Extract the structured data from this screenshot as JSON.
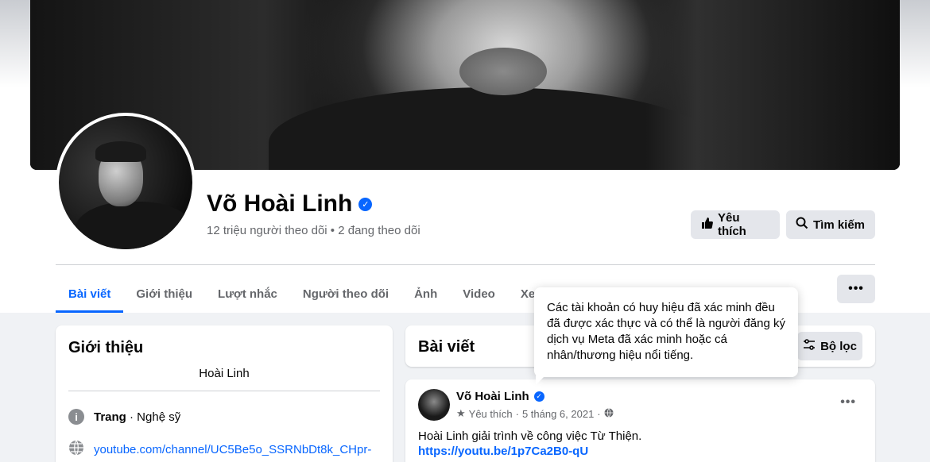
{
  "profile": {
    "name": "Võ Hoài Linh",
    "followers": "12 triệu người theo dõi • 2 đang theo dõi"
  },
  "actions": {
    "like_label": "Yêu thích",
    "search_label": "Tìm kiếm"
  },
  "tabs": [
    {
      "label": "Bài viết",
      "active": true
    },
    {
      "label": "Giới thiệu"
    },
    {
      "label": "Lượt nhắc"
    },
    {
      "label": "Người theo dõi"
    },
    {
      "label": "Ảnh"
    },
    {
      "label": "Video"
    },
    {
      "label": "Xem thêm ▾"
    }
  ],
  "more_label": "•••",
  "intro": {
    "title": "Giới thiệu",
    "alias": "Hoài Linh",
    "page_type_bold": "Trang",
    "page_type_rest": " · Nghệ sỹ",
    "website": "youtube.com/channel/UC5Be5o_SSRNbDt8k_CHpr-"
  },
  "posts": {
    "title": "Bài viết",
    "filter_label": "Bộ lọc"
  },
  "post": {
    "author": "Võ Hoài Linh",
    "meta_label": "Yêu thích",
    "date": "5 tháng 6, 2021",
    "text": "Hoài Linh giải trình về công việc Từ Thiện.",
    "link": "https://youtu.be/1p7Ca2B0-qU"
  },
  "tooltip": {
    "text": "Các tài khoản có huy hiệu đã xác minh đều đã được xác thực và có thể là người đăng ký dịch vụ Meta đã xác minh hoặc cá nhân/thương hiệu nổi tiếng."
  },
  "colors": {
    "accent": "#0866ff",
    "background": "#f0f2f5",
    "button": "#e4e6eb"
  }
}
